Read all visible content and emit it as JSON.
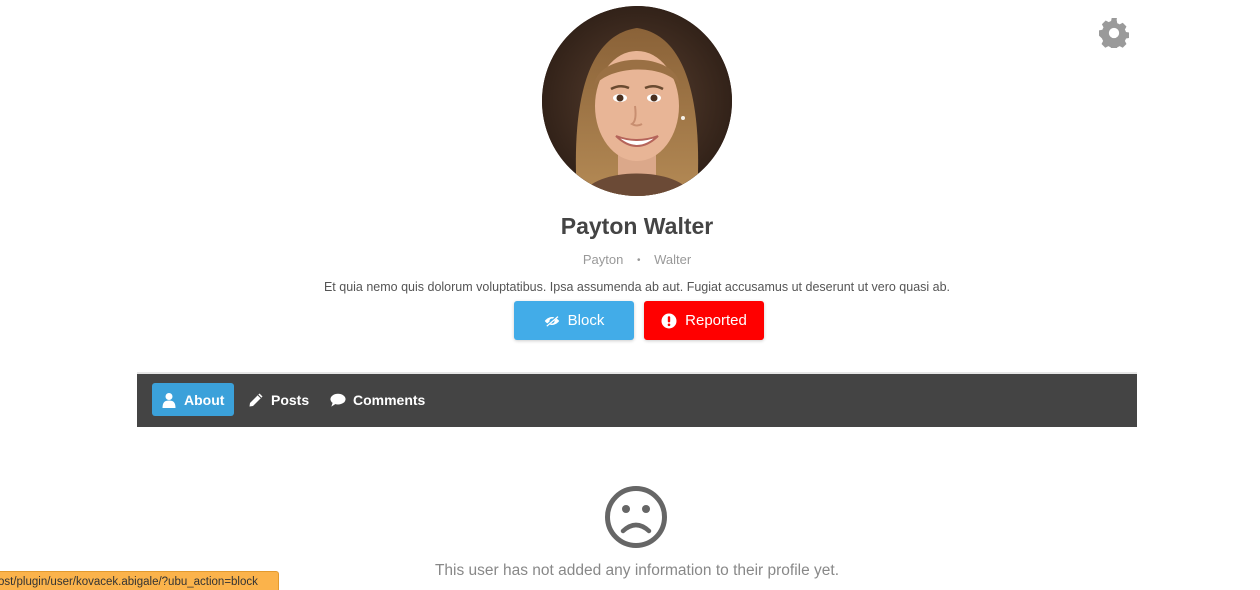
{
  "profile": {
    "name": "Payton Walter",
    "first_name": "Payton",
    "separator": "•",
    "last_name": "Walter",
    "bio": "Et quia nemo quis dolorum voluptatibus. Ipsa assumenda ab aut. Fugiat accusamus ut deserunt ut vero quasi ab."
  },
  "actions": {
    "block_label": "Block",
    "reported_label": "Reported"
  },
  "tabs": [
    {
      "label": "About",
      "icon": "user-icon",
      "active": true
    },
    {
      "label": "Posts",
      "icon": "pencil-icon",
      "active": false
    },
    {
      "label": "Comments",
      "icon": "comment-icon",
      "active": false
    }
  ],
  "content": {
    "empty_message": "This user has not added any information to their profile yet.",
    "icon": "sad-face-icon"
  },
  "status_bar": {
    "url": "ost/plugin/user/kovacek.abigale/?ubu_action=block"
  },
  "colors": {
    "block_button": "#42ace8",
    "reported_button": "#ff0000",
    "navbar": "#444444",
    "active_tab": "#3ba1da",
    "status_bar": "#fbb34b"
  }
}
